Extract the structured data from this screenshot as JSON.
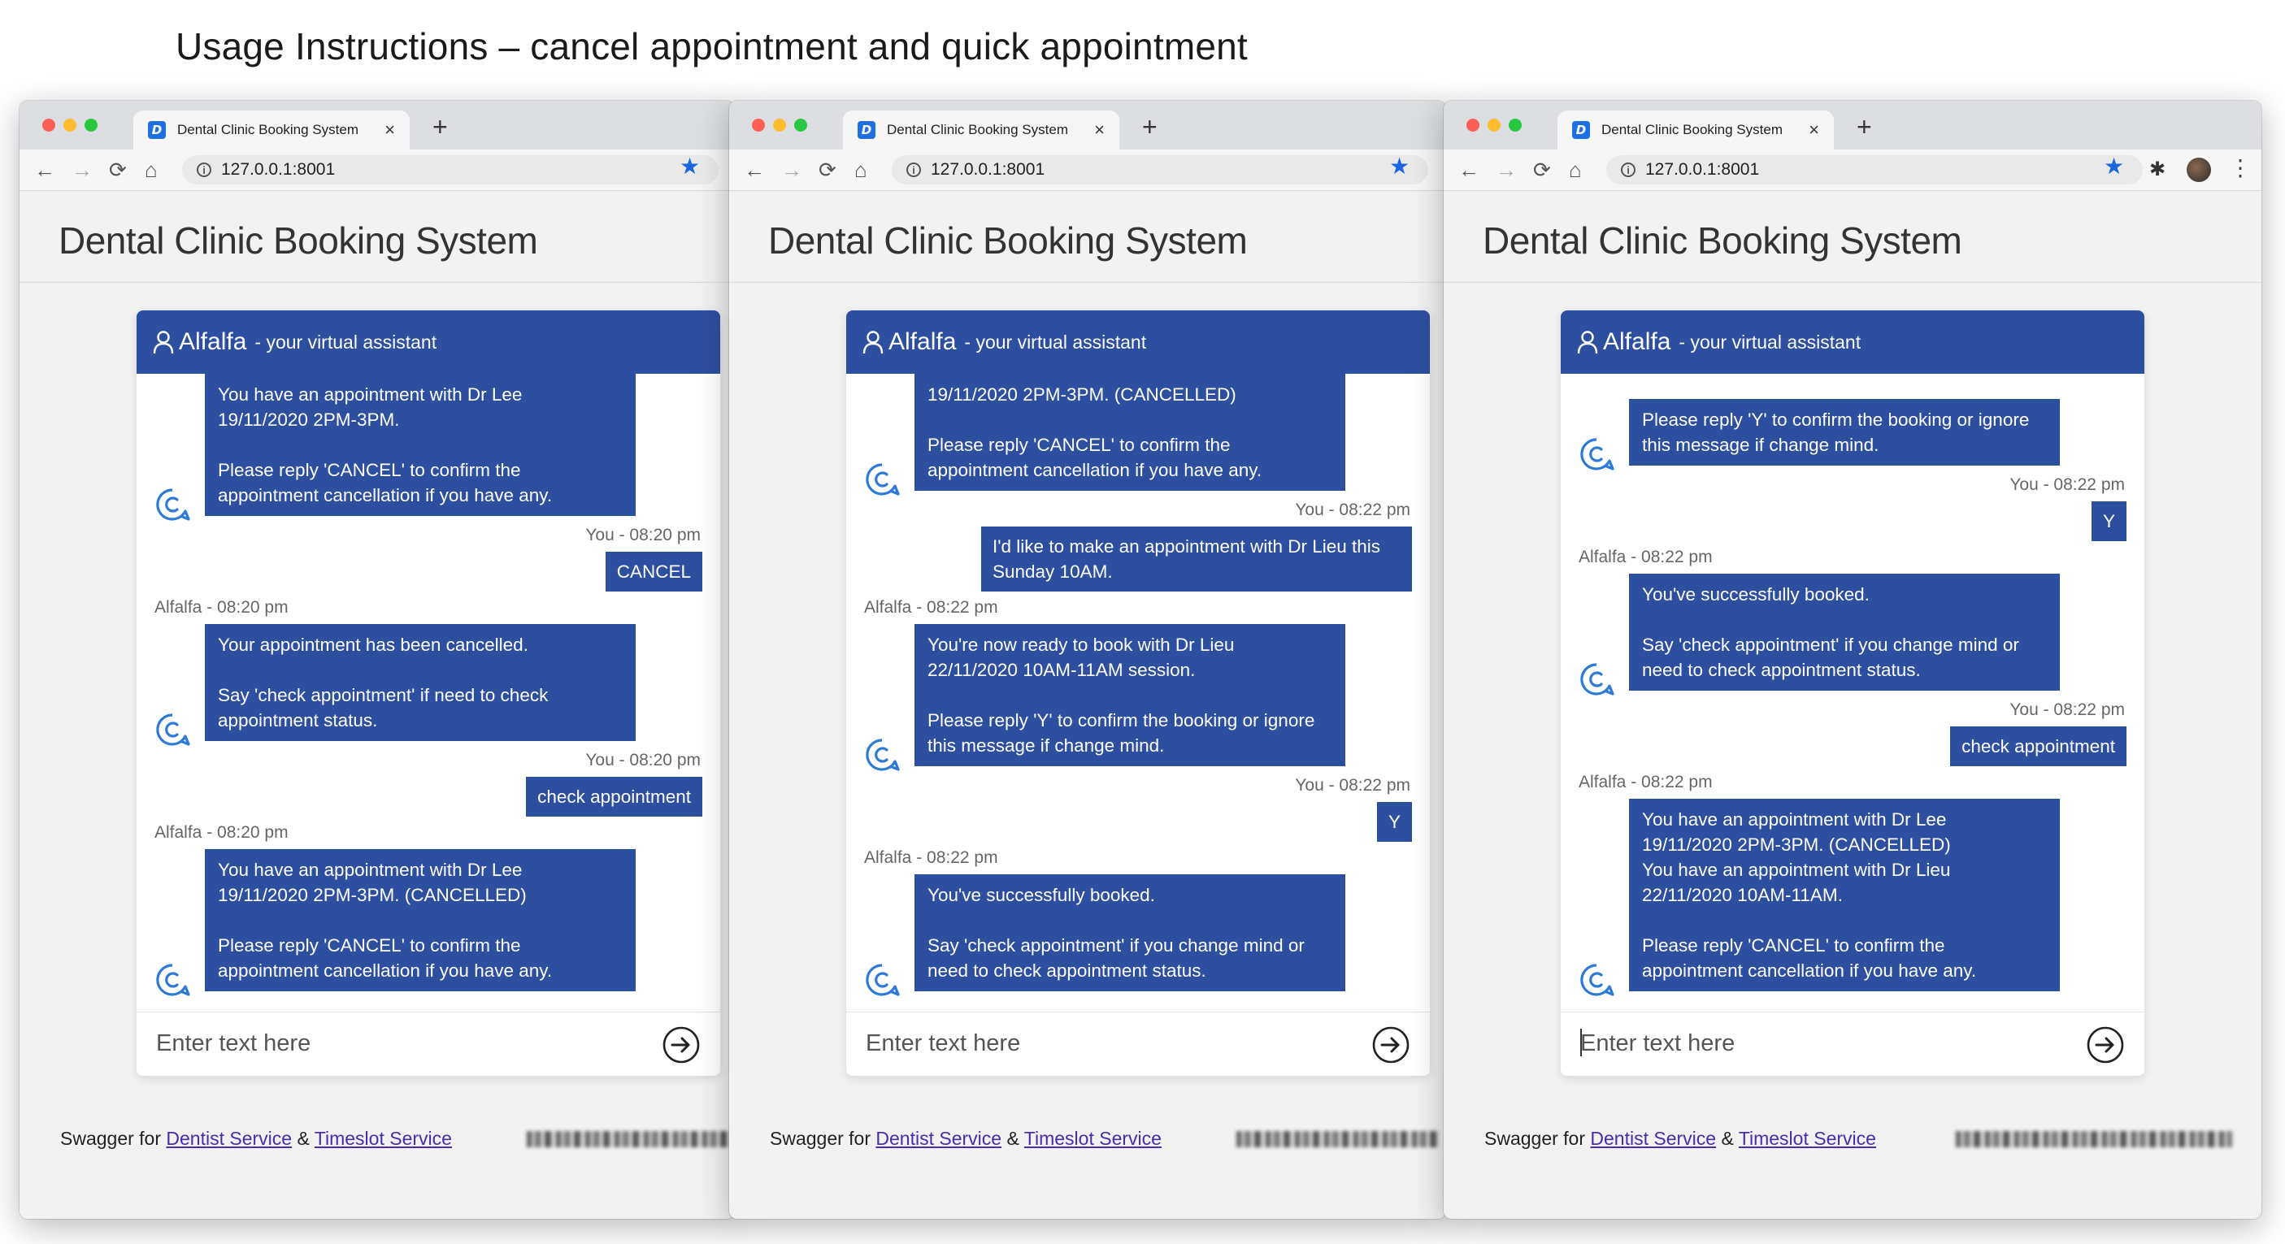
{
  "slide_title": "Usage Instructions – cancel appointment and quick appointment",
  "browser": {
    "tab_title": "Dental Clinic Booking System",
    "favicon_letter": "D",
    "url": "127.0.0.1:8001",
    "tab_close_glyph": "×",
    "new_tab_glyph": "+",
    "back_glyph": "←",
    "forward_glyph": "→",
    "reload_glyph": "⟳",
    "home_glyph": "⌂",
    "star_glyph": "★",
    "extensions_glyph": "✱",
    "menu_glyph": "⋮"
  },
  "app": {
    "title": "Dental Clinic Booking System",
    "bot_name": "Alfalfa",
    "bot_subtitle": "- your virtual assistant",
    "input_placeholder": "Enter text here"
  },
  "footer": {
    "prefix": "Swagger for ",
    "link1": "Dentist Service",
    "sep": " & ",
    "link2": "Timeslot Service"
  },
  "colors": {
    "bubble": "#2d4f9f",
    "header": "#2d4f9f",
    "link": "#4a2bb0"
  },
  "windows": [
    {
      "messages": [
        {
          "from": "bot",
          "lines": [
            "You have an appointment with Dr Lee",
            "19/11/2020 2PM-3PM.",
            "",
            "Please reply 'CANCEL' to confirm the",
            "appointment cancellation if you have any."
          ]
        },
        {
          "from": "user",
          "meta": "You - 08:20 pm",
          "text": "CANCEL"
        },
        {
          "from": "bot",
          "meta": "Alfalfa - 08:20 pm",
          "lines": [
            "Your appointment has been cancelled.",
            "",
            "Say 'check appointment' if need to check",
            "appointment status."
          ]
        },
        {
          "from": "user",
          "meta": "You - 08:20 pm",
          "text": "check appointment"
        },
        {
          "from": "bot",
          "meta": "Alfalfa - 08:20 pm",
          "lines": [
            "You have an appointment with Dr Lee",
            "19/11/2020 2PM-3PM. (CANCELLED)",
            "",
            "Please reply 'CANCEL' to confirm the",
            "appointment cancellation if you have any."
          ]
        }
      ]
    },
    {
      "messages": [
        {
          "from": "bot",
          "lines": [
            "19/11/2020 2PM-3PM. (CANCELLED)",
            "",
            "Please reply 'CANCEL' to confirm the",
            "appointment cancellation if you have any."
          ]
        },
        {
          "from": "user",
          "meta": "You - 08:22 pm",
          "text": "I'd like to make an appointment with Dr Lieu this Sunday 10AM."
        },
        {
          "from": "bot",
          "meta": "Alfalfa - 08:22 pm",
          "lines": [
            "You're now ready to book with Dr Lieu",
            "22/11/2020 10AM-11AM session.",
            "",
            "Please reply 'Y' to confirm the booking or ignore",
            "this message if change mind."
          ]
        },
        {
          "from": "user",
          "meta": "You - 08:22 pm",
          "text": "Y"
        },
        {
          "from": "bot",
          "meta": "Alfalfa - 08:22 pm",
          "lines": [
            "You've successfully booked.",
            "",
            "Say 'check appointment' if you change mind or",
            "need to check appointment status."
          ]
        }
      ]
    },
    {
      "messages": [
        {
          "from": "bot",
          "lines": [
            "Please reply 'Y' to confirm the booking or ignore",
            "this message if change mind."
          ]
        },
        {
          "from": "user",
          "meta": "You - 08:22 pm",
          "text": "Y"
        },
        {
          "from": "bot",
          "meta": "Alfalfa - 08:22 pm",
          "lines": [
            "You've successfully booked.",
            "",
            "Say 'check appointment' if you change mind or",
            "need to check appointment status."
          ]
        },
        {
          "from": "user",
          "meta": "You - 08:22 pm",
          "text": "check appointment"
        },
        {
          "from": "bot",
          "meta": "Alfalfa - 08:22 pm",
          "lines": [
            "You have an appointment with Dr Lee",
            "19/11/2020 2PM-3PM. (CANCELLED)",
            "You have an appointment with Dr Lieu",
            "22/11/2020 10AM-11AM.",
            "",
            "Please reply 'CANCEL' to confirm the",
            "appointment cancellation if you have any."
          ]
        }
      ]
    }
  ]
}
